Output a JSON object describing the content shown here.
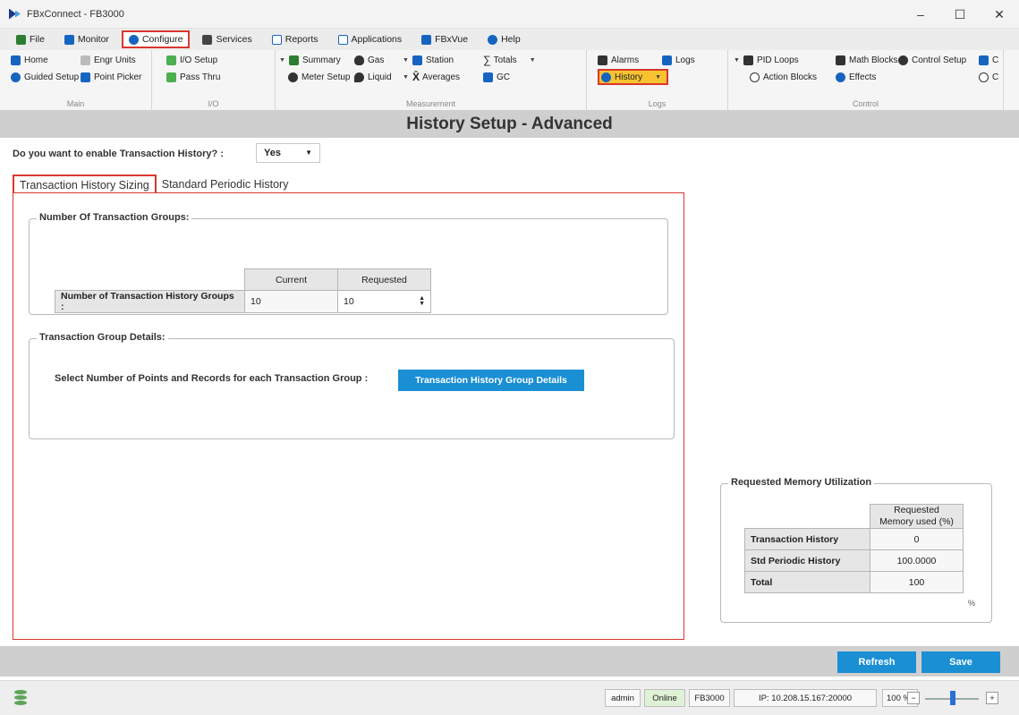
{
  "window": {
    "title": "FBxConnect - FB3000",
    "min_label": "–",
    "max_label": "☐",
    "close_label": "✕"
  },
  "menu": {
    "items": [
      {
        "label": "File",
        "icon": "file-icon",
        "color": "#2e7d32"
      },
      {
        "label": "Monitor",
        "icon": "monitor-icon",
        "color": "#1565c0"
      },
      {
        "label": "Configure",
        "icon": "configure-icon",
        "color": "#1565c0",
        "active": true
      },
      {
        "label": "Services",
        "icon": "services-icon",
        "color": "#333333"
      },
      {
        "label": "Reports",
        "icon": "reports-icon",
        "color": "#1565c0"
      },
      {
        "label": "Applications",
        "icon": "applications-icon",
        "color": "#1565c0"
      },
      {
        "label": "FBxVue",
        "icon": "fbxvue-icon",
        "color": "#1565c0"
      },
      {
        "label": "Help",
        "icon": "help-icon",
        "color": "#1565c0"
      }
    ]
  },
  "ribbon": {
    "main": {
      "label": "Main",
      "home": "Home",
      "guided_setup": "Guided Setup",
      "engr_units": "Engr Units",
      "point_picker": "Point Picker"
    },
    "io": {
      "label": "I/O",
      "io_setup": "I/O Setup",
      "pass_thru": "Pass Thru"
    },
    "measurement": {
      "label": "Measurement",
      "summary": "Summary",
      "meter_setup": "Meter Setup",
      "gas": "Gas",
      "liquid": "Liquid",
      "station": "Station",
      "averages": "Averages",
      "totals": "Totals",
      "gc": "GC"
    },
    "logs": {
      "label": "Logs",
      "alarms": "Alarms",
      "history": "History",
      "logs": "Logs"
    },
    "control": {
      "label": "Control",
      "pid_loops": "PID Loops",
      "action_blocks": "Action Blocks",
      "math_blocks": "Math Blocks",
      "effects": "Effects",
      "control_setup": "Control Setup",
      "overflow_1": "C",
      "overflow_2": "C"
    }
  },
  "page": {
    "title": "History Setup - Advanced",
    "enable_question": "Do you want to enable Transaction History? :",
    "enable_value": "Yes",
    "tabs": [
      "Transaction History Sizing",
      "Standard Periodic History"
    ]
  },
  "groups_box": {
    "legend": "Number Of Transaction Groups:",
    "col_current": "Current",
    "col_requested": "Requested",
    "row_label": "Number of Transaction History Groups :",
    "current": "10",
    "requested": "10"
  },
  "details_box": {
    "legend": "Transaction Group Details:",
    "label": "Select Number of Points and Records for each Transaction Group :",
    "button": "Transaction History Group Details"
  },
  "memory": {
    "legend": "Requested Memory Utilization",
    "col_header": "Requested Memory used (%)",
    "rows": [
      {
        "label": "Transaction History",
        "value": "0"
      },
      {
        "label": "Std Periodic History",
        "value": "100.0000"
      },
      {
        "label": "Total",
        "value": "100"
      }
    ],
    "unit": "%"
  },
  "actions": {
    "refresh": "Refresh",
    "save": "Save"
  },
  "status": {
    "user": "admin",
    "connection": "Online",
    "device": "FB3000",
    "ip": "IP: 10.208.15.167:20000",
    "zoom": "100 %"
  },
  "colors": {
    "accent": "#1b8fd3",
    "highlight": "#d9372e",
    "history_bg": "#f7c330",
    "online_bg": "#dff2d5"
  }
}
